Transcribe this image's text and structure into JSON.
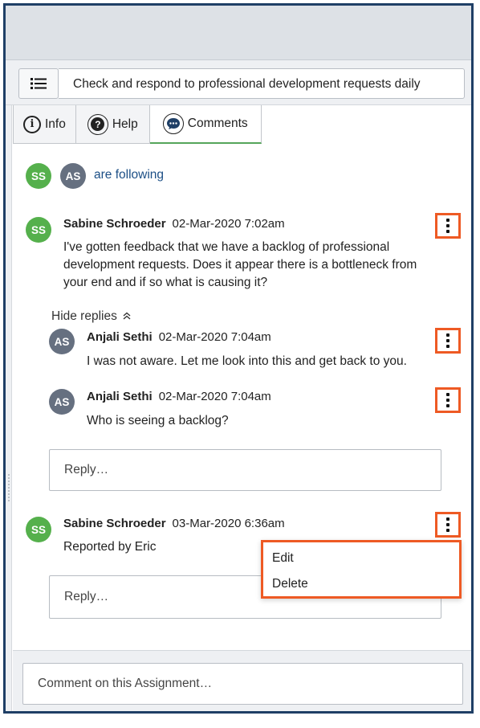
{
  "task": {
    "title": "Check and respond to professional development requests daily"
  },
  "tabs": [
    {
      "label": "Info",
      "icon": "info-icon"
    },
    {
      "label": "Help",
      "icon": "help-icon"
    },
    {
      "label": "Comments",
      "icon": "comment-bubble-icon",
      "active": true
    }
  ],
  "followers": {
    "initials": [
      "SS",
      "AS"
    ],
    "text": "are following"
  },
  "comments": [
    {
      "initials": "SS",
      "author": "Sabine Schroeder",
      "date": "02-Mar-2020 7:02am",
      "lines": [
        "I've gotten feedback that we have a backlog of professional",
        "development requests. Does it appear there is a bottleneck from",
        "your end and if so what is causing it?"
      ],
      "replies_toggle": "Hide replies",
      "replies": [
        {
          "initials": "AS",
          "author": "Anjali Sethi",
          "date": "02-Mar-2020 7:04am",
          "text": "I was not aware. Let me look into this and get back to you."
        },
        {
          "initials": "AS",
          "author": "Anjali Sethi",
          "date": "02-Mar-2020 7:04am",
          "text": "Who is seeing a backlog?"
        }
      ],
      "reply_placeholder": "Reply…"
    },
    {
      "initials": "SS",
      "author": "Sabine Schroeder",
      "date": "03-Mar-2020 6:36am",
      "text": "Reported by Eric",
      "reply_placeholder": "Reply…"
    }
  ],
  "context_menu": {
    "items": [
      "Edit",
      "Delete"
    ]
  },
  "footer": {
    "placeholder": "Comment on this Assignment…"
  },
  "colors": {
    "highlight": "#ee5a24",
    "avatar_ss": "#55b04c",
    "avatar_as": "#667080",
    "link": "#1c4f86",
    "frame": "#1f3f66"
  }
}
